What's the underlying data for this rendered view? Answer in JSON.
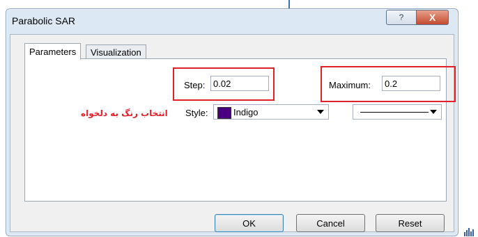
{
  "window": {
    "title": "Parabolic SAR",
    "help_glyph": "?",
    "close_glyph": "X"
  },
  "tabs": [
    {
      "label": "Parameters",
      "active": true
    },
    {
      "label": "Visualization",
      "active": false
    }
  ],
  "params": {
    "step_label": "Step:",
    "step_value": "0.02",
    "maximum_label": "Maximum:",
    "maximum_value": "0.2",
    "style_label": "Style:",
    "color_name": "Indigo",
    "color_hex": "#4b0082",
    "line_style": "solid"
  },
  "annotation": {
    "text": "انتخاب رنگ به دلخواه",
    "color": "#e3202a"
  },
  "buttons": {
    "ok": "OK",
    "cancel": "Cancel",
    "reset": "Reset"
  },
  "colors": {
    "highlight_red": "#e3202a"
  }
}
